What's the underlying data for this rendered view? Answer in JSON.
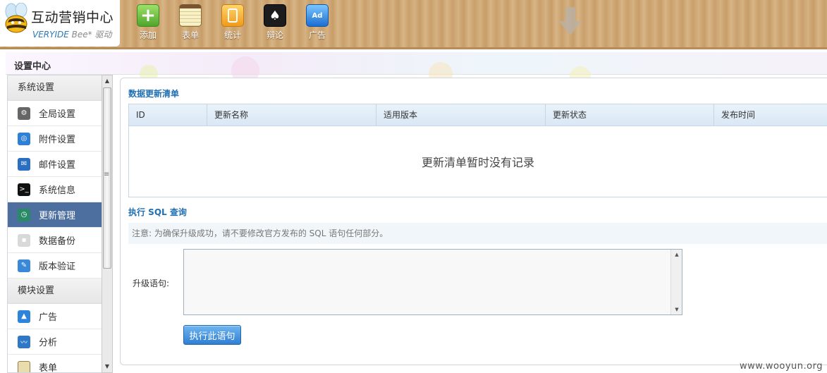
{
  "logo": {
    "title": "互动营销中心",
    "sub_a": "VERYIDE",
    "sub_b": "Bee*",
    "sub_c": "驱动"
  },
  "toolbar": [
    {
      "label": "添加",
      "icon": "plus-icon"
    },
    {
      "label": "表单",
      "icon": "notepad-icon"
    },
    {
      "label": "统计",
      "icon": "ipod-icon"
    },
    {
      "label": "辩论",
      "icon": "cards-icon"
    },
    {
      "label": "广告",
      "icon": "ad-icon",
      "badge": "Ad"
    }
  ],
  "settings_header": {
    "title": "设置中心"
  },
  "sidebar": {
    "group_system": "系统设置",
    "items": [
      {
        "label": "全局设置",
        "icon": "gear-icon",
        "active": false
      },
      {
        "label": "附件设置",
        "icon": "attachment-icon",
        "active": false
      },
      {
        "label": "邮件设置",
        "icon": "mail-icon",
        "active": false
      },
      {
        "label": "系统信息",
        "icon": "terminal-icon",
        "active": false
      },
      {
        "label": "更新管理",
        "icon": "clock-icon",
        "active": true
      },
      {
        "label": "数据备份",
        "icon": "backup-icon",
        "active": false
      },
      {
        "label": "版本验证",
        "icon": "verify-icon",
        "active": false
      }
    ],
    "group_module": "模块设置",
    "module_items": [
      {
        "label": "广告",
        "icon": "ad-icon"
      },
      {
        "label": "分析",
        "icon": "chart-icon"
      },
      {
        "label": "表单",
        "icon": "notepad-icon"
      }
    ]
  },
  "updates": {
    "title": "数据更新清单",
    "columns": [
      "ID",
      "更新名称",
      "适用版本",
      "更新状态",
      "发布时间"
    ],
    "empty_message": "更新清单暂时没有记录"
  },
  "sql": {
    "title": "执行 SQL 查询",
    "notice": "注意: 为确保升级成功，请不要修改官方发布的 SQL 语句任何部分。",
    "field_label": "升级语句:",
    "value": "",
    "button_label": "执行此语句"
  },
  "watermark": "www.wooyun.org",
  "colors": {
    "accent": "#1e6fb3",
    "active_item": "#4d6fa0",
    "button": "#2f7fd2"
  }
}
